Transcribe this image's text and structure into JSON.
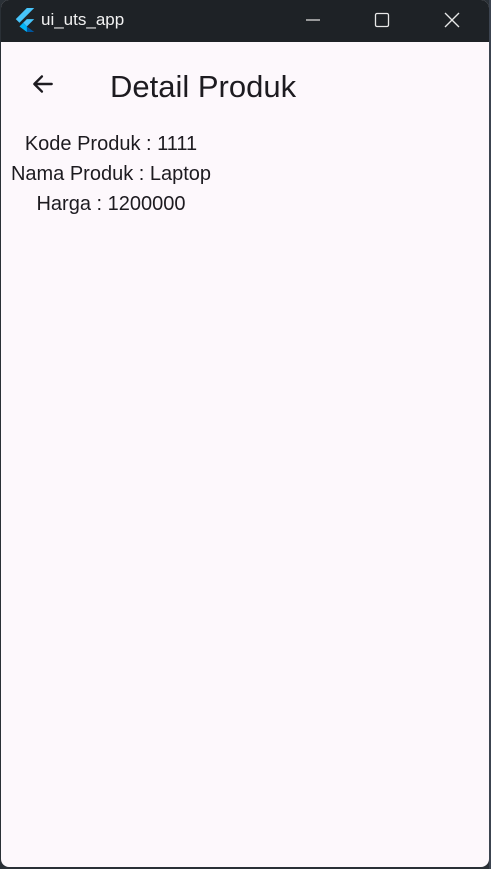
{
  "window": {
    "title": "ui_uts_app",
    "icon": "flutter-logo-icon",
    "controls": [
      "minimize-icon",
      "maximize-icon",
      "close-icon"
    ]
  },
  "appbar": {
    "back_icon": "arrow-back-icon",
    "title": "Detail Produk"
  },
  "product": {
    "kode": "Kode Produk : 1111",
    "nama": "Nama Produk : Laptop",
    "harga": "Harga : 1200000"
  },
  "colors": {
    "titlebar_bg": "#1e2226",
    "page_bg": "#fdf8fc",
    "text": "#1d1b20",
    "flutter_blue": "#47c5fb",
    "flutter_dark": "#00569e"
  }
}
